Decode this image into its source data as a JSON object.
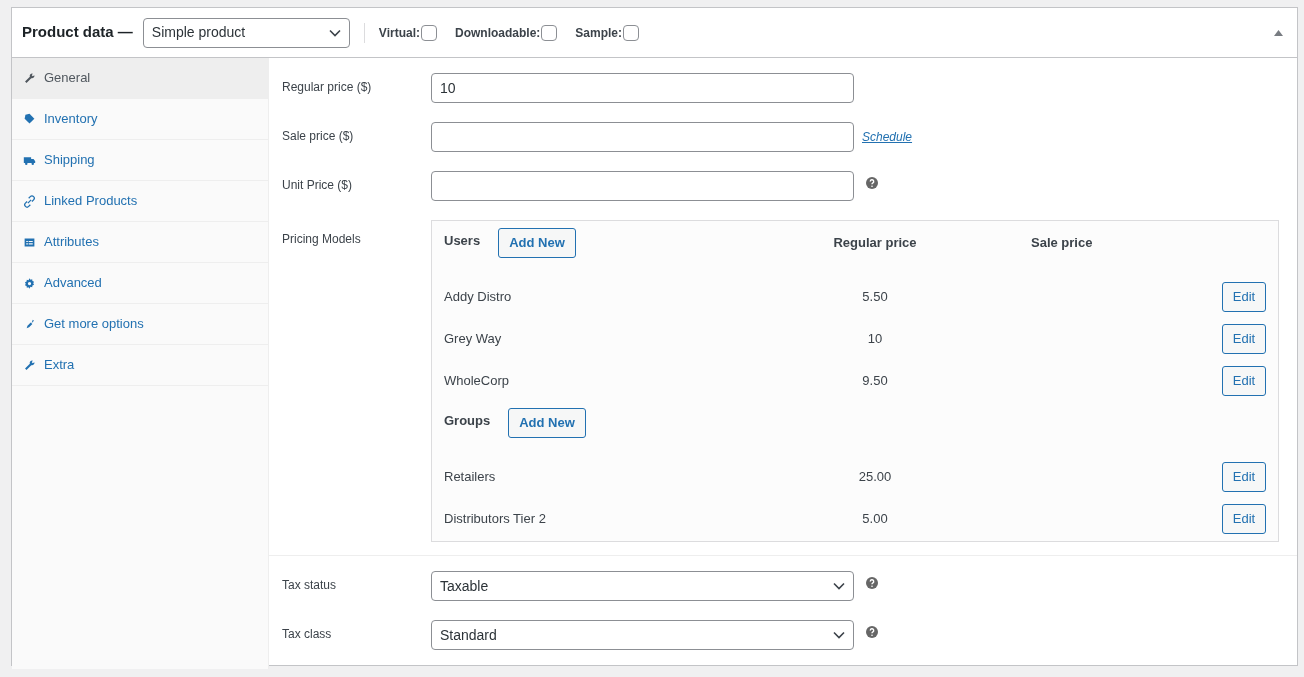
{
  "header": {
    "title": "Product data —",
    "product_type": "Simple product",
    "options": [
      {
        "label": "Virtual:",
        "checked": false
      },
      {
        "label": "Downloadable:",
        "checked": false
      },
      {
        "label": "Sample:",
        "checked": false
      }
    ]
  },
  "tabs": [
    {
      "label": "General",
      "selected": true
    },
    {
      "label": "Inventory",
      "selected": false
    },
    {
      "label": "Shipping",
      "selected": false
    },
    {
      "label": "Linked Products",
      "selected": false
    },
    {
      "label": "Attributes",
      "selected": false
    },
    {
      "label": "Advanced",
      "selected": false
    },
    {
      "label": "Get more options",
      "selected": false
    },
    {
      "label": "Extra",
      "selected": false
    }
  ],
  "price_fields": [
    {
      "label": "Regular price ($)",
      "value": "10",
      "help": false
    },
    {
      "label": "Sale price ($)",
      "link": "Schedule",
      "help": false
    },
    {
      "label": "Unit Price ($)",
      "help": true
    }
  ],
  "pricing_models": {
    "label": "Pricing Models",
    "columns": [
      "Regular price",
      "Sale price"
    ],
    "sections": [
      {
        "heading": "Users",
        "button": "Add New",
        "rows": [
          {
            "name": "Addy Distro",
            "regular_price": "5.50",
            "button": "Edit"
          },
          {
            "name": "Grey Way",
            "regular_price": "10",
            "button": "Edit"
          },
          {
            "name": "WholeCorp",
            "regular_price": "9.50",
            "button": "Edit"
          }
        ]
      },
      {
        "heading": "Groups",
        "button": "Add New",
        "rows": [
          {
            "name": "Retailers",
            "regular_price": "25.00",
            "button": "Edit"
          },
          {
            "name": "Distributors Tier 2",
            "regular_price": "5.00",
            "button": "Edit"
          }
        ]
      }
    ]
  },
  "tax_fields": [
    {
      "label": "Tax status",
      "value": "Taxable",
      "help": true
    },
    {
      "label": "Tax class",
      "value": "Standard",
      "help": true
    }
  ]
}
